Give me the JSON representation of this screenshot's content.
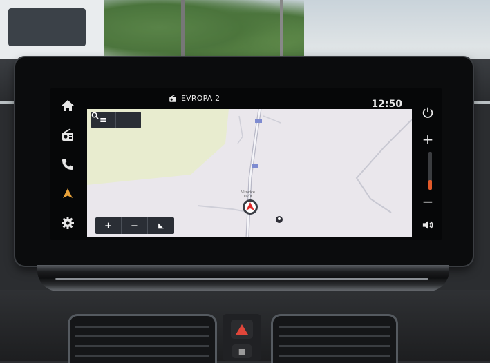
{
  "header": {
    "station_name": "EVROPA 2",
    "clock": "12:50"
  },
  "left_rail": [
    {
      "name": "home",
      "icon": "home-icon"
    },
    {
      "name": "radio",
      "icon": "radio-icon"
    },
    {
      "name": "phone",
      "icon": "phone-icon"
    },
    {
      "name": "navigation",
      "icon": "navigation-arrow-icon",
      "active": true
    },
    {
      "name": "settings",
      "icon": "gear-icon"
    }
  ],
  "map": {
    "top_controls": {
      "menu_icon": "≡",
      "search_icon": "search-icon"
    },
    "zoom_controls": {
      "zoom_in": "+",
      "zoom_out": "−",
      "recenter_icon": "◣"
    },
    "place_label": "Vitovice",
    "place_sublabel": "Dvůr"
  },
  "right_rail": {
    "power_icon": "power-icon",
    "volume_up": "+",
    "volume_down": "−",
    "volume_level": 0.25,
    "mute_icon": "speaker-icon"
  },
  "colors": {
    "accent": "#e8a23a",
    "map_land": "#eae7ec",
    "map_green": "#e8eccf",
    "position_marker": "#e02a2a",
    "volume_fill": "#e25a2a"
  }
}
